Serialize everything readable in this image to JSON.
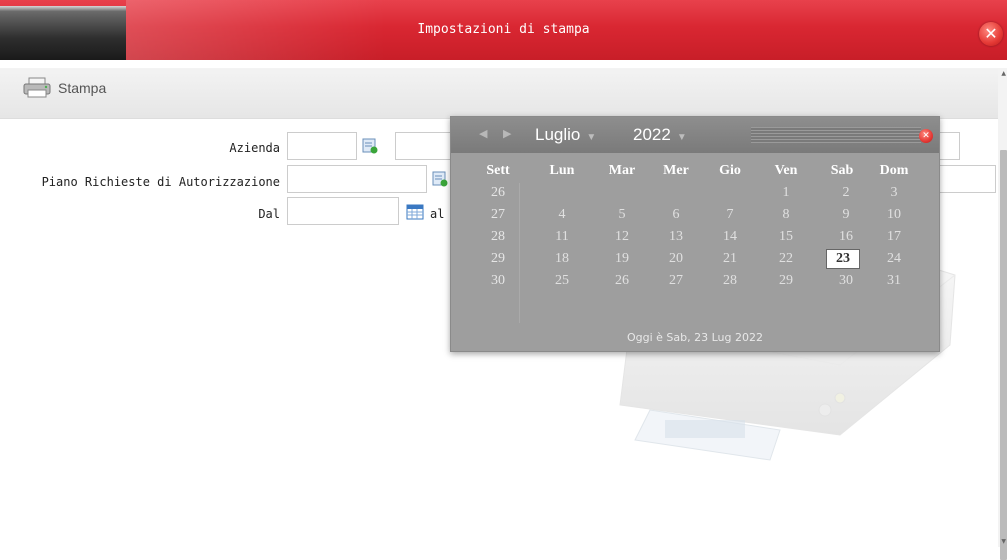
{
  "window": {
    "title": "Impostazioni di stampa",
    "close_icon": "close-icon"
  },
  "toolbar": {
    "print_label": "Stampa",
    "print_icon": "printer-icon"
  },
  "form": {
    "azienda_label": "Azienda",
    "piano_label": "Piano Richieste di Autorizzazione",
    "dal_label": "Dal",
    "al_label": "al",
    "azienda_code": "",
    "azienda_desc": "",
    "piano_code": "",
    "piano_desc": "",
    "dal_value": ""
  },
  "calendar": {
    "month": "Luglio",
    "year": "2022",
    "headers": [
      "Sett",
      "Lun",
      "Mar",
      "Mer",
      "Gio",
      "Ven",
      "Sab",
      "Dom"
    ],
    "weeks": [
      [
        "26",
        "",
        "",
        "",
        "",
        "1",
        "2",
        "3"
      ],
      [
        "27",
        "4",
        "5",
        "6",
        "7",
        "8",
        "9",
        "10"
      ],
      [
        "28",
        "11",
        "12",
        "13",
        "14",
        "15",
        "16",
        "17"
      ],
      [
        "29",
        "18",
        "19",
        "20",
        "21",
        "22",
        "23",
        "24"
      ],
      [
        "30",
        "25",
        "26",
        "27",
        "28",
        "29",
        "30",
        "31"
      ]
    ],
    "selected_day": "23",
    "footer": "Oggi è Sab, 23 Lug 2022"
  },
  "colors": {
    "title_bar": "#d92732",
    "calendar_bg": "#9e9e9e"
  }
}
